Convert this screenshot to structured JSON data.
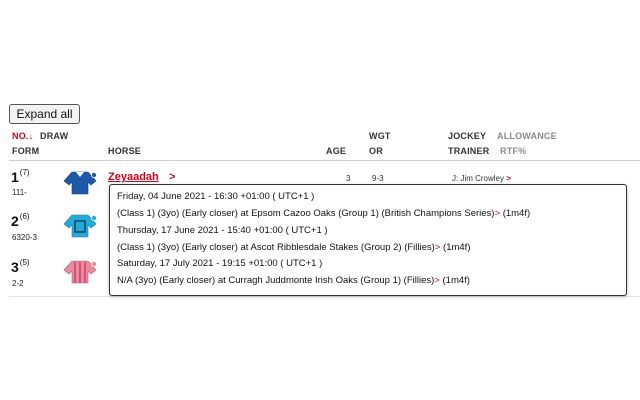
{
  "toolbar": {
    "expand_all_label": "Expand all"
  },
  "headers": {
    "no": "NO.",
    "sort_arrow": "↓",
    "draw": "DRAW",
    "form": "FORM",
    "horse": "HORSE",
    "age": "AGE",
    "wgt": "WGT",
    "or": "OR",
    "jockey": "JOCKEY",
    "allowance": "ALLOWANCE",
    "trainer": "TRAINER",
    "rtf": "RTF%"
  },
  "runners": [
    {
      "number": "1",
      "draw": "(7)",
      "form": "111-",
      "horse": "Zeyaadah",
      "horse_chevron": ">",
      "age": "3",
      "weight": "9-3",
      "jockey": "J: Jim Crowley",
      "jockey_chevron": ">",
      "silk_colors": [
        "#1f5aa8",
        "#ffffff"
      ]
    },
    {
      "number": "2",
      "draw": "(6)",
      "form": "6320-3",
      "silk_colors": [
        "#27a9d8",
        "#ffffff"
      ]
    },
    {
      "number": "3",
      "draw": "(5)",
      "form": "2-2",
      "silk_colors": [
        "#e88aa0",
        "#c73f5e"
      ]
    }
  ],
  "entries_popup": [
    {
      "date": "Friday, 04 June 2021 - 16:30 +01:00 ( UTC+1 )",
      "race": "(Class 1) (3yo) (Early closer) at Epsom Cazoo Oaks (Group 1) (British Champions Series)",
      "chevron": ">",
      "distance": "(1m4f)"
    },
    {
      "date": "Thursday, 17 June 2021 - 15:40 +01:00 ( UTC+1 )",
      "race": "(Class 1) (3yo) (Early closer) at Ascot Ribblesdale Stakes (Group 2) (Fillies)",
      "chevron": ">",
      "distance": "(1m4f)"
    },
    {
      "date": "Saturday, 17 July 2021 - 19:15 +01:00 ( UTC+1 )",
      "race": "N/A (3yo) (Early closer) at Curragh Juddmonte Irish Oaks (Group 1) (Fillies)",
      "chevron": ">",
      "distance": "(1m4f)"
    }
  ],
  "colors": {
    "accent_red": "#d0021b"
  }
}
